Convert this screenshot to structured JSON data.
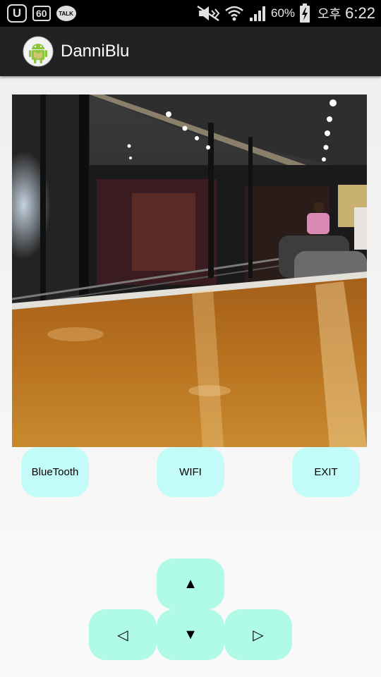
{
  "status_bar": {
    "left_icons": [
      "u-plus-icon",
      "lte-60-icon",
      "kakaotalk-icon"
    ],
    "u_label": "U",
    "sixty_label": "60",
    "talk_label": "TALK",
    "right_icons": [
      "mute-icon",
      "wifi-icon",
      "signal-icon",
      "battery-charging-icon"
    ],
    "battery_percent": "60%",
    "ampm": "오후",
    "time": "6:22"
  },
  "action_bar": {
    "title": "DanniBlu",
    "icon": "android-app-icon"
  },
  "camera": {
    "icon": "camera-feed-image"
  },
  "buttons": {
    "bluetooth": "BlueTooth",
    "wifi": "WIFI",
    "exit": "EXIT"
  },
  "dpad": {
    "up": "▲",
    "left": "◁",
    "down": "▼",
    "right": "▷"
  },
  "colors": {
    "top_buttons": "#c2fbf7",
    "dpad_buttons": "#b0fbe8",
    "action_bar": "#222222",
    "status_bar": "#000000"
  }
}
